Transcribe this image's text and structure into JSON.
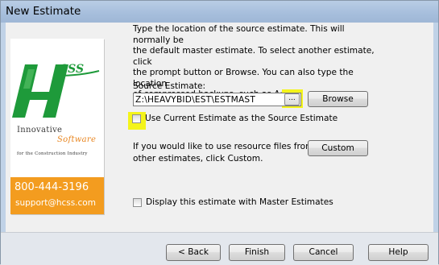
{
  "window": {
    "title": "New Estimate"
  },
  "logo": {
    "brand": "HCSS",
    "tagline_line1": "Innovative",
    "tagline_line2": "Software",
    "tagline_line3": "for the Construction Industry",
    "phone": "800-444-3196",
    "email": "support@hcss.com"
  },
  "description": {
    "line1": "Type the location of the source estimate.  This will normally be",
    "line2": "the default master estimate.  To select another estimate, click",
    "line3": "the prompt button or Browse.  You can also type the location",
    "line4": "of compressed backups, such as A:"
  },
  "source_estimate": {
    "label": "Source Estimate:",
    "value": "Z:\\HEAVYBID\\EST\\ESTMAST",
    "dots_label": "...",
    "browse_label": "Browse"
  },
  "use_current": {
    "label": "Use Current Estimate as the Source Estimate",
    "checked": false
  },
  "custom": {
    "line1": "If you would like to use resource files from",
    "line2": "other estimates, click Custom.",
    "button_label": "Custom"
  },
  "display_master": {
    "label": "Display this estimate with Master Estimates",
    "checked": false
  },
  "footer": {
    "back_label": "< Back",
    "finish_label": "Finish",
    "cancel_label": "Cancel",
    "help_label": "Help"
  },
  "colors": {
    "highlight": "#f4f41a",
    "logo_green": "#1e9a3a",
    "logo_orange": "#f39c1f"
  }
}
